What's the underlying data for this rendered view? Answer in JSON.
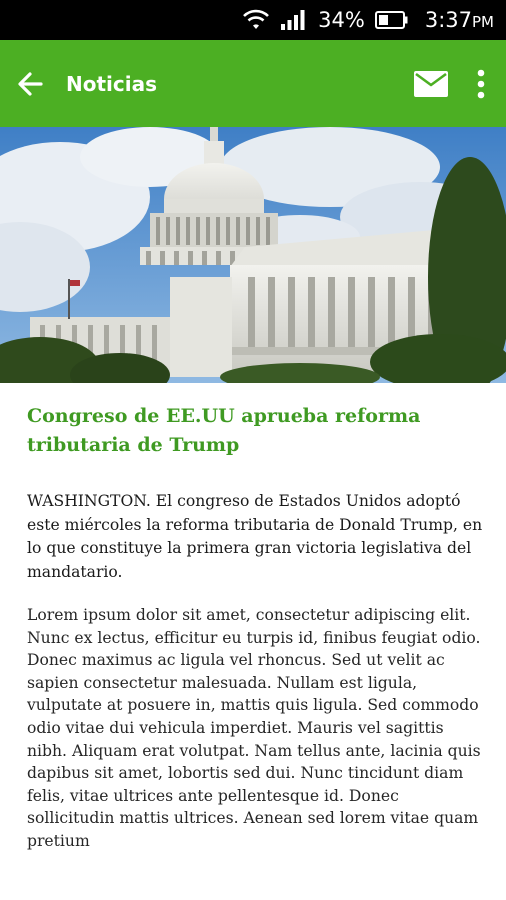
{
  "status_bar": {
    "battery_percent": "34%",
    "time": "3:37",
    "time_suffix": "PM",
    "icons": [
      "wifi-icon",
      "signal-icon",
      "battery-icon"
    ]
  },
  "app_bar": {
    "title": "Noticias",
    "background_color": "#4caf23",
    "icons": [
      "back-arrow-icon",
      "mail-icon",
      "more-vert-icon"
    ]
  },
  "article": {
    "title": "Congreso de EE.UU aprueba reforma tributaria de Trump",
    "title_color": "#3f9a22",
    "lead": "WASHINGTON. El congreso de Estados Unidos adoptó este miércoles la reforma tributaria de Donald Trump, en lo que constituye la primera gran victoria legislativa del mandatario.",
    "body": "Lorem ipsum dolor sit amet, consectetur adipiscing elit. Nunc ex lectus, efficitur eu turpis id, finibus feugiat odio. Donec maximus ac ligula vel rhoncus. Sed ut velit ac sapien consectetur malesuada. Nullam est ligula, vulputate at posuere in, mattis quis ligula. Sed commodo odio vitae dui vehicula imperdiet. Mauris vel sagittis nibh. Aliquam erat volutpat. Nam tellus ante, lacinia quis dapibus sit amet, lobortis sed dui. Nunc tincidunt diam felis, vitae ultrices ante pellentesque id. Donec sollicitudin mattis ultrices. Aenean sed lorem vitae quam pretium"
  }
}
